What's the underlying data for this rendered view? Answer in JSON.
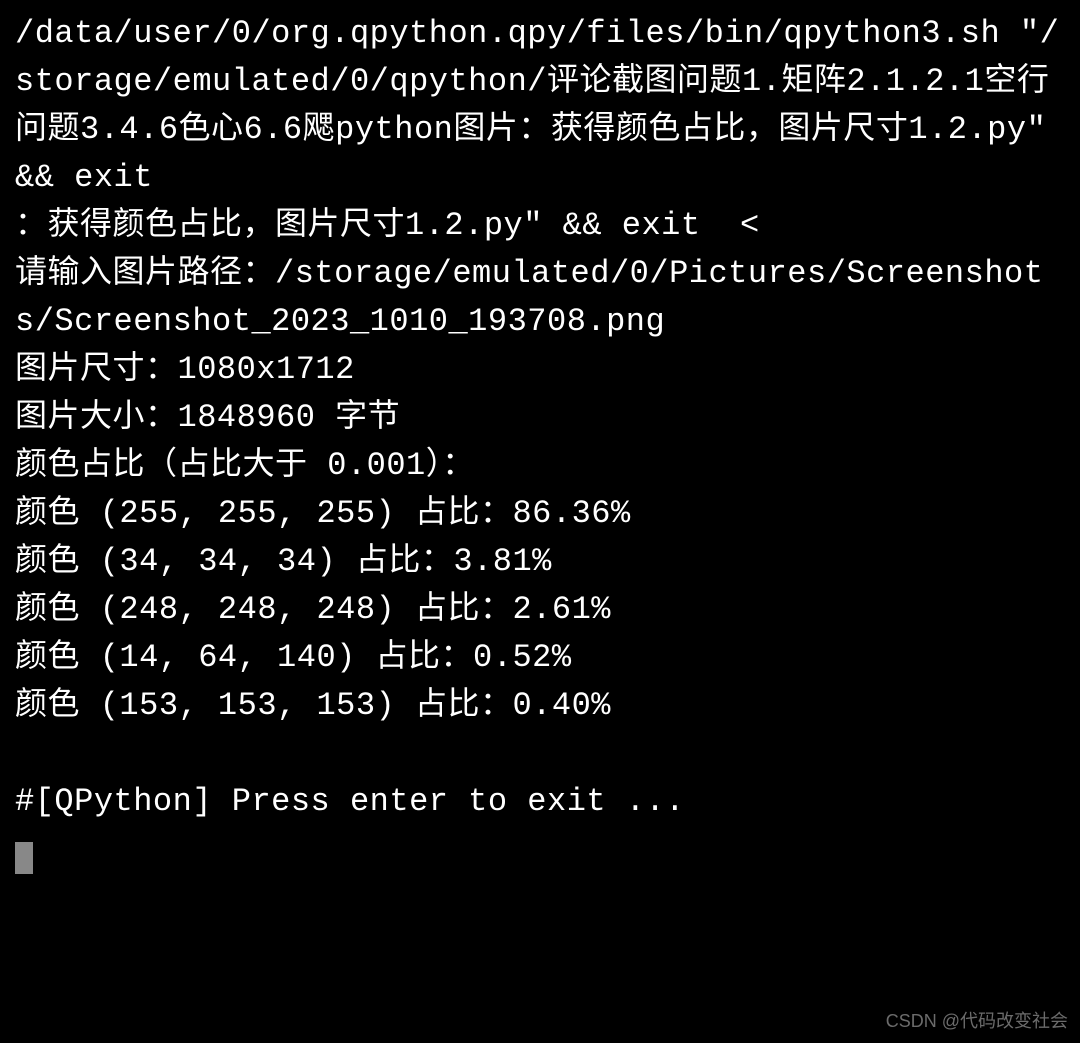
{
  "terminal": {
    "command_line": "/data/user/0/org.qpython.qpy/files/bin/qpython3.sh \"/storage/emulated/0/qpython/评论截图问题1.矩阵2.1.2.1空行问题3.4.6色心6.6飔python图片：获得颜色占比，图片尺寸1.2.py\" && exit",
    "echo_line": "：获得颜色占比，图片尺寸1.2.py\" && exit  <",
    "input_prompt": "请输入图片路径：/storage/emulated/0/Pictures/Screenshots/Screenshot_2023_1010_193708.png",
    "image_dimensions": "图片尺寸：1080x1712",
    "image_size": "图片大小：1848960 字节",
    "ratio_header": "颜色占比（占比大于 0.001）：",
    "colors": [
      "颜色 (255, 255, 255) 占比：86.36%",
      "颜色 (34, 34, 34) 占比：3.81%",
      "颜色 (248, 248, 248) 占比：2.61%",
      "颜色 (14, 64, 140) 占比：0.52%",
      "颜色 (153, 153, 153) 占比：0.40%"
    ],
    "exit_prompt": "#[QPython] Press enter to exit ..."
  },
  "watermark": "CSDN @代码改变社会"
}
